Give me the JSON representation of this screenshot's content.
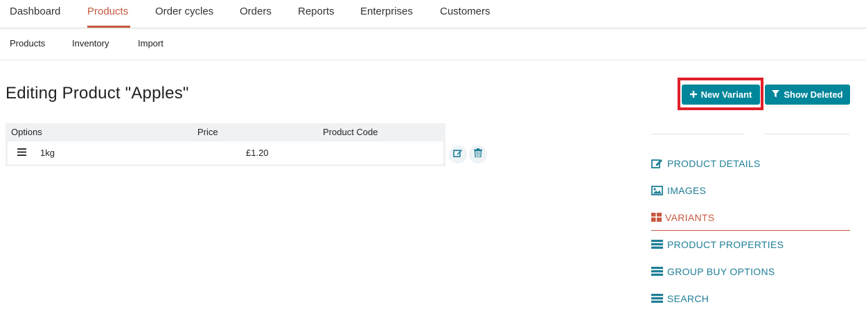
{
  "topnav": {
    "items": [
      {
        "label": "Dashboard"
      },
      {
        "label": "Products"
      },
      {
        "label": "Order cycles"
      },
      {
        "label": "Orders"
      },
      {
        "label": "Reports"
      },
      {
        "label": "Enterprises"
      },
      {
        "label": "Customers"
      }
    ],
    "active_color": "#c8583e"
  },
  "subnav": {
    "items": [
      {
        "label": "Products"
      },
      {
        "label": "Inventory"
      },
      {
        "label": "Import"
      }
    ]
  },
  "page": {
    "title": "Editing Product \"Apples\""
  },
  "actions": {
    "new_variant": "New Variant",
    "show_deleted": "Show Deleted",
    "button_color": "#00869a"
  },
  "table": {
    "columns": [
      "Options",
      "Price",
      "Product Code"
    ],
    "rows": [
      {
        "option": "1kg",
        "price": "£1.20",
        "code": ""
      }
    ]
  },
  "sidebar": {
    "items": [
      {
        "label": "PRODUCT DETAILS",
        "icon": "edit-icon"
      },
      {
        "label": "IMAGES",
        "icon": "image-icon"
      },
      {
        "label": "VARIANTS",
        "icon": "grid-icon"
      },
      {
        "label": "PRODUCT PROPERTIES",
        "icon": "list-icon"
      },
      {
        "label": "GROUP BUY OPTIONS",
        "icon": "list-icon"
      },
      {
        "label": "SEARCH",
        "icon": "list-icon"
      }
    ],
    "link_color": "#1f7f97"
  }
}
